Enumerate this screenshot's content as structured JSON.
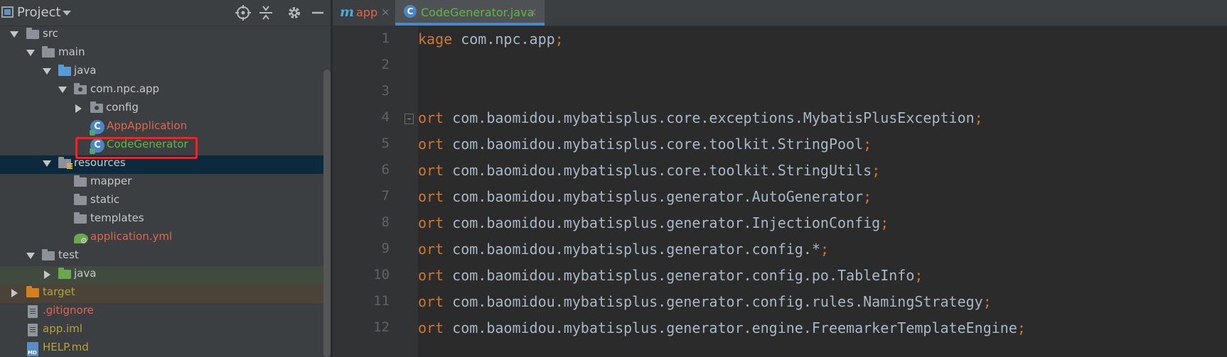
{
  "project_panel": {
    "title": "Project",
    "tree": [
      {
        "label": "src"
      },
      {
        "label": "main"
      },
      {
        "label": "java"
      },
      {
        "label": "com.npc.app"
      },
      {
        "label": "config"
      },
      {
        "label": "AppApplication"
      },
      {
        "label": "CodeGenerator"
      },
      {
        "label": "resources"
      },
      {
        "label": "mapper"
      },
      {
        "label": "static"
      },
      {
        "label": "templates"
      },
      {
        "label": "application.yml"
      },
      {
        "label": "test"
      },
      {
        "label": "java"
      },
      {
        "label": "target"
      },
      {
        "label": ".gitignore"
      },
      {
        "label": "app.iml"
      },
      {
        "label": "HELP.md"
      }
    ]
  },
  "editor": {
    "tabs": [
      {
        "label": "app",
        "close": "×"
      },
      {
        "label": "CodeGenerator.java",
        "close": "×"
      }
    ],
    "lines": [
      {
        "num": "1",
        "kw": "kage",
        "text": " com.npc.app",
        "semi": ";"
      },
      {
        "num": "2",
        "kw": "",
        "text": "",
        "semi": ""
      },
      {
        "num": "3",
        "kw": "",
        "text": "",
        "semi": ""
      },
      {
        "num": "4",
        "kw": "ort",
        "text": " com.baomidou.mybatisplus.core.exceptions.MybatisPlusException",
        "semi": ";"
      },
      {
        "num": "5",
        "kw": "ort",
        "text": " com.baomidou.mybatisplus.core.toolkit.StringPool",
        "semi": ";"
      },
      {
        "num": "6",
        "kw": "ort",
        "text": " com.baomidou.mybatisplus.core.toolkit.StringUtils",
        "semi": ";"
      },
      {
        "num": "7",
        "kw": "ort",
        "text": " com.baomidou.mybatisplus.generator.AutoGenerator",
        "semi": ";"
      },
      {
        "num": "8",
        "kw": "ort",
        "text": " com.baomidou.mybatisplus.generator.InjectionConfig",
        "semi": ";"
      },
      {
        "num": "9",
        "kw": "ort",
        "text": " com.baomidou.mybatisplus.generator.config.*",
        "semi": ";"
      },
      {
        "num": "10",
        "kw": "ort",
        "text": " com.baomidou.mybatisplus.generator.config.po.TableInfo",
        "semi": ";"
      },
      {
        "num": "11",
        "kw": "ort",
        "text": " com.baomidou.mybatisplus.generator.config.rules.NamingStrategy",
        "semi": ";"
      },
      {
        "num": "12",
        "kw": "ort",
        "text": " com.baomidou.mybatisplus.generator.engine.FreemarkerTemplateEngine",
        "semi": ";"
      }
    ]
  },
  "colors": {
    "panel_bg": "#3c3f41",
    "editor_bg": "#2b2b2b",
    "keyword": "#cc7832",
    "code_text": "#a9b7c6",
    "file_red": "#e0664f",
    "file_green": "#62b543",
    "selection": "#0d293e",
    "highlight_box": "#ff1e1e"
  }
}
